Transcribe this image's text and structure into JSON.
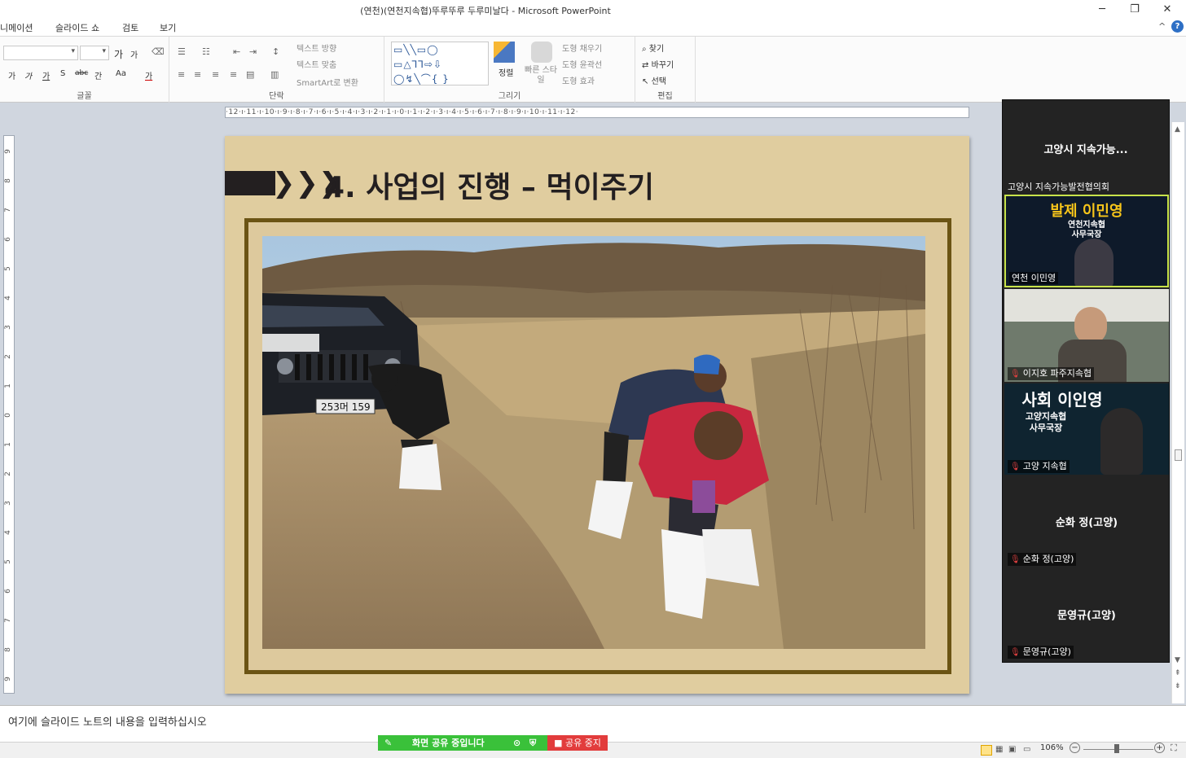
{
  "window": {
    "title": "(연천)(연천지속협)뚜루뚜루 두루미날다  -  Microsoft PowerPoint",
    "minimize": "─",
    "restore": "❐",
    "close": "✕"
  },
  "menu": {
    "items": [
      "니메이션",
      "슬라이드 쇼",
      "검토",
      "보기"
    ],
    "caret": "^",
    "help": "?"
  },
  "ribbon": {
    "font_group_label": "글꼴",
    "paragraph_group_label": "단락",
    "drawing_group_label": "그리기",
    "edit_group_label": "편집",
    "text_direction": "텍스트 방향",
    "text_align": "텍스트 맞춤",
    "smartart_convert": "SmartArt로 변환",
    "arrange": "정렬",
    "quick_styles": "빠른 스타일",
    "shape_fill": "도형 채우기",
    "shape_outline": "도형 윤곽선",
    "shape_effects": "도형 효과",
    "find": "찾기",
    "replace": "바꾸기",
    "select": "선택",
    "font_buttons": [
      "가",
      "가",
      "가",
      "S",
      "abc",
      "간",
      "Aa",
      "가"
    ],
    "grow_font": "가",
    "shrink_font": "가"
  },
  "ruler": {
    "horizontal": "·12·ı·11·ı·10·ı·9·ı·8·ı·7·ı·6·ı·5·ı·4·ı·3·ı·2·ı·1·ı·0·ı·1·ı·2·ı·3·ı·4·ı·5·ı·6·ı·7·ı·8·ı·9·ı·10·ı·11·ı·12·",
    "vertical": [
      "9",
      "8",
      "7",
      "6",
      "5",
      "4",
      "3",
      "2",
      "1",
      "0",
      "1",
      "2",
      "3",
      "4",
      "5",
      "6",
      "7",
      "8",
      "9"
    ]
  },
  "slide": {
    "title": "4. 사업의 진행 – 먹이주기",
    "chevrons": "❯❯❯",
    "plate": "253머 159"
  },
  "meeting": {
    "panel_title": "고양시 지속가능...",
    "group_label": "고양시 지속가능발전협의회",
    "tiles": [
      {
        "banner_main": "발제 이민영",
        "banner_sub1": "연천지속협",
        "banner_sub2": "사무국장",
        "name": "연천 이민영",
        "muted": false
      },
      {
        "banner_main": "",
        "banner_sub1": "",
        "banner_sub2": "",
        "name": "이지호 파주지속협",
        "muted": true
      },
      {
        "banner_main": "사회 이인영",
        "banner_sub1": "고양지속협",
        "banner_sub2": "사무국장",
        "name": "고양 지속협",
        "muted": true
      },
      {
        "center_name": "순화 정(고양)",
        "name": "순화 정(고양)",
        "muted": true
      },
      {
        "center_name": "문영규(고양)",
        "name": "문영규(고양)",
        "muted": true
      }
    ],
    "mute_icon": "🎙",
    "sharing_text": "화면 공유 중입니다",
    "stop_share": "■ 공유 중지"
  },
  "notes": {
    "placeholder": "여기에 슬라이드 노트의 내용을 입력하십시오"
  },
  "status": {
    "zoom": "106%",
    "zoom_minus": "−",
    "zoom_plus": "+"
  },
  "colors": {
    "slide_bg": "#e0cd9f",
    "frame": "#6b5414",
    "share_green": "#3ac13a",
    "stop_red": "#e23c3c",
    "panel_bg": "#232323",
    "active_speaker": "#c8e34a"
  }
}
